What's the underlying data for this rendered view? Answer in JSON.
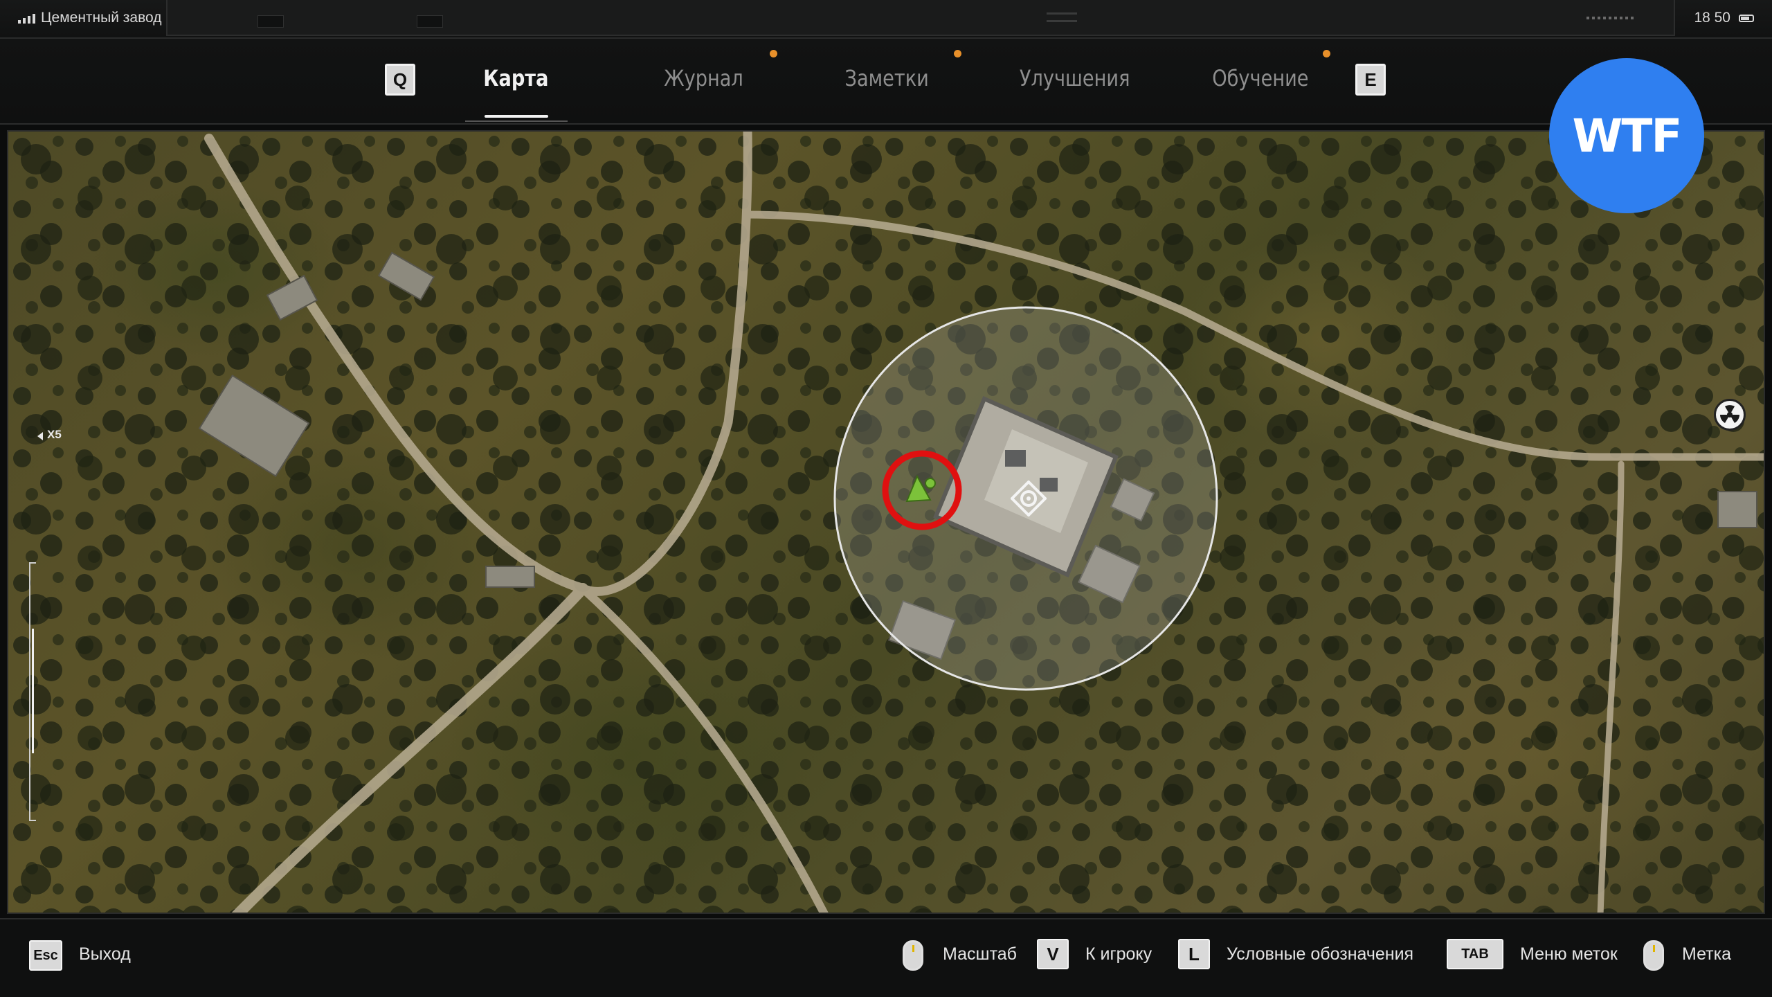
{
  "status": {
    "location": "Цементный завод",
    "time": "18 50"
  },
  "nav": {
    "prev_key": "Q",
    "next_key": "E",
    "tabs": [
      {
        "label": "Карта",
        "active": true,
        "notification": false
      },
      {
        "label": "Журнал",
        "active": false,
        "notification": true
      },
      {
        "label": "Заметки",
        "active": false,
        "notification": true
      },
      {
        "label": "Улучшения",
        "active": false,
        "notification": false
      },
      {
        "label": "Обучение",
        "active": false,
        "notification": true
      }
    ]
  },
  "map": {
    "zoom_label": "X5",
    "icons": [
      "player-marker-icon",
      "target-marker-icon",
      "radiation-icon"
    ]
  },
  "badge": {
    "text": "WTF",
    "color": "#2f7ff0"
  },
  "hints": {
    "exit_key": "Esc",
    "exit_label": "Выход",
    "zoom_label": "Масштаб",
    "to_player_key": "V",
    "to_player_label": "К игроку",
    "legend_key": "L",
    "legend_label": "Условные обозначения",
    "marks_menu_key": "TAB",
    "marks_menu_label": "Меню меток",
    "mark_label": "Метка"
  },
  "colors": {
    "notification": "#e8902a",
    "player_marker": "#7cc23a",
    "highlight_ring": "#e01010"
  }
}
